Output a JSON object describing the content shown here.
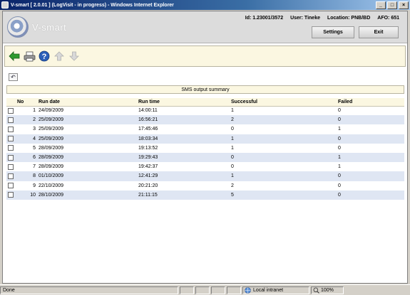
{
  "window": {
    "title": "V-smart [ 2.0.01 ] (LogVisit - in progress) - Windows Internet Explorer",
    "minimize": "_",
    "maximize": "□",
    "close": "×"
  },
  "header": {
    "brand": "V-smart",
    "session": {
      "id": "Id: 1.23001/3572",
      "user": "User: Tineke",
      "location": "Location: PNB/BD",
      "afo": "AFO: 651"
    },
    "settings_label": "Settings",
    "exit_label": "Exit"
  },
  "section_title": "SMS output summary",
  "table": {
    "columns": [
      "No",
      "Run date",
      "Run time",
      "Successful",
      "Failed"
    ],
    "rows": [
      [
        "1",
        "24/09/2009",
        "14:00:11",
        "1",
        "0"
      ],
      [
        "2",
        "25/09/2009",
        "16:56:21",
        "2",
        "0"
      ],
      [
        "3",
        "25/09/2009",
        "17:45:46",
        "0",
        "1"
      ],
      [
        "4",
        "25/09/2009",
        "18:03:34",
        "1",
        "0"
      ],
      [
        "5",
        "28/09/2009",
        "19:13:52",
        "1",
        "0"
      ],
      [
        "6",
        "28/09/2009",
        "19:29:43",
        "0",
        "1"
      ],
      [
        "7",
        "28/09/2009",
        "19:42:37",
        "0",
        "1"
      ],
      [
        "8",
        "01/10/2009",
        "12:41:29",
        "1",
        "0"
      ],
      [
        "9",
        "22/10/2009",
        "20:21:20",
        "2",
        "0"
      ],
      [
        "10",
        "28/10/2009",
        "21:11:15",
        "5",
        "0"
      ]
    ]
  },
  "statusbar": {
    "left": "Done",
    "zone": "Local intranet",
    "zoom": "100%"
  },
  "colors": {
    "title_bar": "#0a246a",
    "toolbar_bg": "#fbf7e1",
    "row_alt": "#dfe6f3",
    "back_arrow": "#2e9a2e",
    "help_icon": "#2a5fb8"
  }
}
